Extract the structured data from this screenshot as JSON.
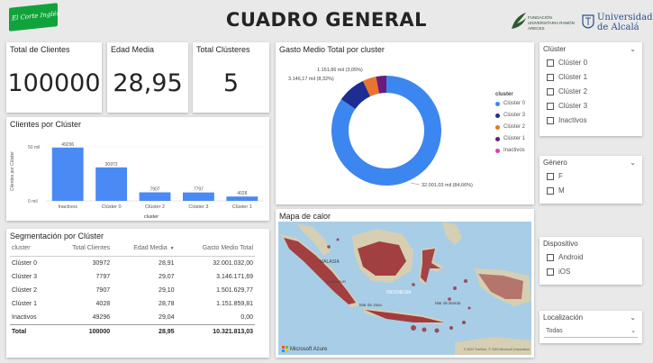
{
  "header": {
    "title": "CUADRO GENERAL",
    "logo_left": "El Corte Inglés",
    "logo_ra_text": "FUNDACIÓN UNIVERSITARIA RAMÓN ARECES",
    "logo_uah_line1": "Universidad",
    "logo_uah_line2": "de Alcalá"
  },
  "kpis": {
    "clientes": {
      "title": "Total de Clientes",
      "value": "100000"
    },
    "edad": {
      "title": "Edad Media",
      "value": "28,95"
    },
    "clusters": {
      "title": "Total Clústeres",
      "value": "5"
    }
  },
  "bar_chart": {
    "title": "Clientes por Clúster",
    "ylabel": "Clientes por Clúster",
    "xlabel": "cluster",
    "ytick_top": "50 mil",
    "ytick_bottom": "0 mil",
    "color": "#4a8af4"
  },
  "donut": {
    "title": "Gasto Medio Total por cluster",
    "legend_title": "cluster",
    "label_small1": "1.151,86 mil (3,05%)",
    "label_small2": "3.146,17 mil (8,32%)",
    "label_big": "32.001,03 mil (84,66%)"
  },
  "map": {
    "title": "Mapa de calor",
    "labels": [
      "MALASIA",
      "SINGAPUR",
      "INDONESIA",
      "Mar de Java",
      "Mar de Banda"
    ],
    "attribution": "Microsoft Azure",
    "copyright": "© 2022 TomTom, © 2022 Microsoft Corporation"
  },
  "table": {
    "title": "Segmentación por Clúster",
    "headers": [
      "cluster",
      "Total Clientes",
      "Edad Media",
      "Gasto Medio Total"
    ],
    "rows": [
      [
        "Clúster 0",
        "30972",
        "28,91",
        "32.001.032,00"
      ],
      [
        "Clúster 3",
        "7797",
        "29,07",
        "3.146.171,69"
      ],
      [
        "Clúster 2",
        "7907",
        "29,10",
        "1.501.629,77"
      ],
      [
        "Clúster 1",
        "4028",
        "28,78",
        "1.151.859,81"
      ],
      [
        "Inactivos",
        "49296",
        "29,04",
        "0,00"
      ]
    ],
    "total": [
      "Total",
      "100000",
      "28,95",
      "10.321.813,03"
    ]
  },
  "slicers": {
    "cluster": {
      "title": "Clúster",
      "items": [
        "Clúster 0",
        "Clúster 1",
        "Clúster 2",
        "Clúster 3",
        "Inactivos"
      ]
    },
    "genero": {
      "title": "Género",
      "items": [
        "F",
        "M"
      ]
    },
    "dispositivo": {
      "title": "Dispositivo",
      "items": [
        "Android",
        "iOS"
      ]
    },
    "localizacion": {
      "title": "Localización",
      "value": "Todas"
    }
  },
  "chart_data": [
    {
      "type": "bar",
      "title": "Clientes por Clúster",
      "xlabel": "cluster",
      "ylabel": "Clientes por Clúster",
      "categories": [
        "Inactivos",
        "Clúster 0",
        "Clúster 2",
        "Clúster 3",
        "Clúster 1"
      ],
      "values": [
        49296,
        30972,
        7907,
        7797,
        4028
      ],
      "data_labels": [
        "49296",
        "30972",
        "7907",
        "7797",
        "4028"
      ],
      "ylim": [
        0,
        50000
      ],
      "grid": true
    },
    {
      "type": "pie",
      "title": "Gasto Medio Total por cluster",
      "legend_title": "cluster",
      "legend_position": "right",
      "categories": [
        "Clúster 0",
        "Clúster 3",
        "Clúster 2",
        "Clúster 1",
        "Inactivos"
      ],
      "values": [
        32001.03,
        3146.17,
        1501.63,
        1151.86,
        0
      ],
      "colors": [
        "#3c86f0",
        "#1d2d92",
        "#e8742e",
        "#6b1b7a",
        "#e040b0"
      ]
    }
  ]
}
